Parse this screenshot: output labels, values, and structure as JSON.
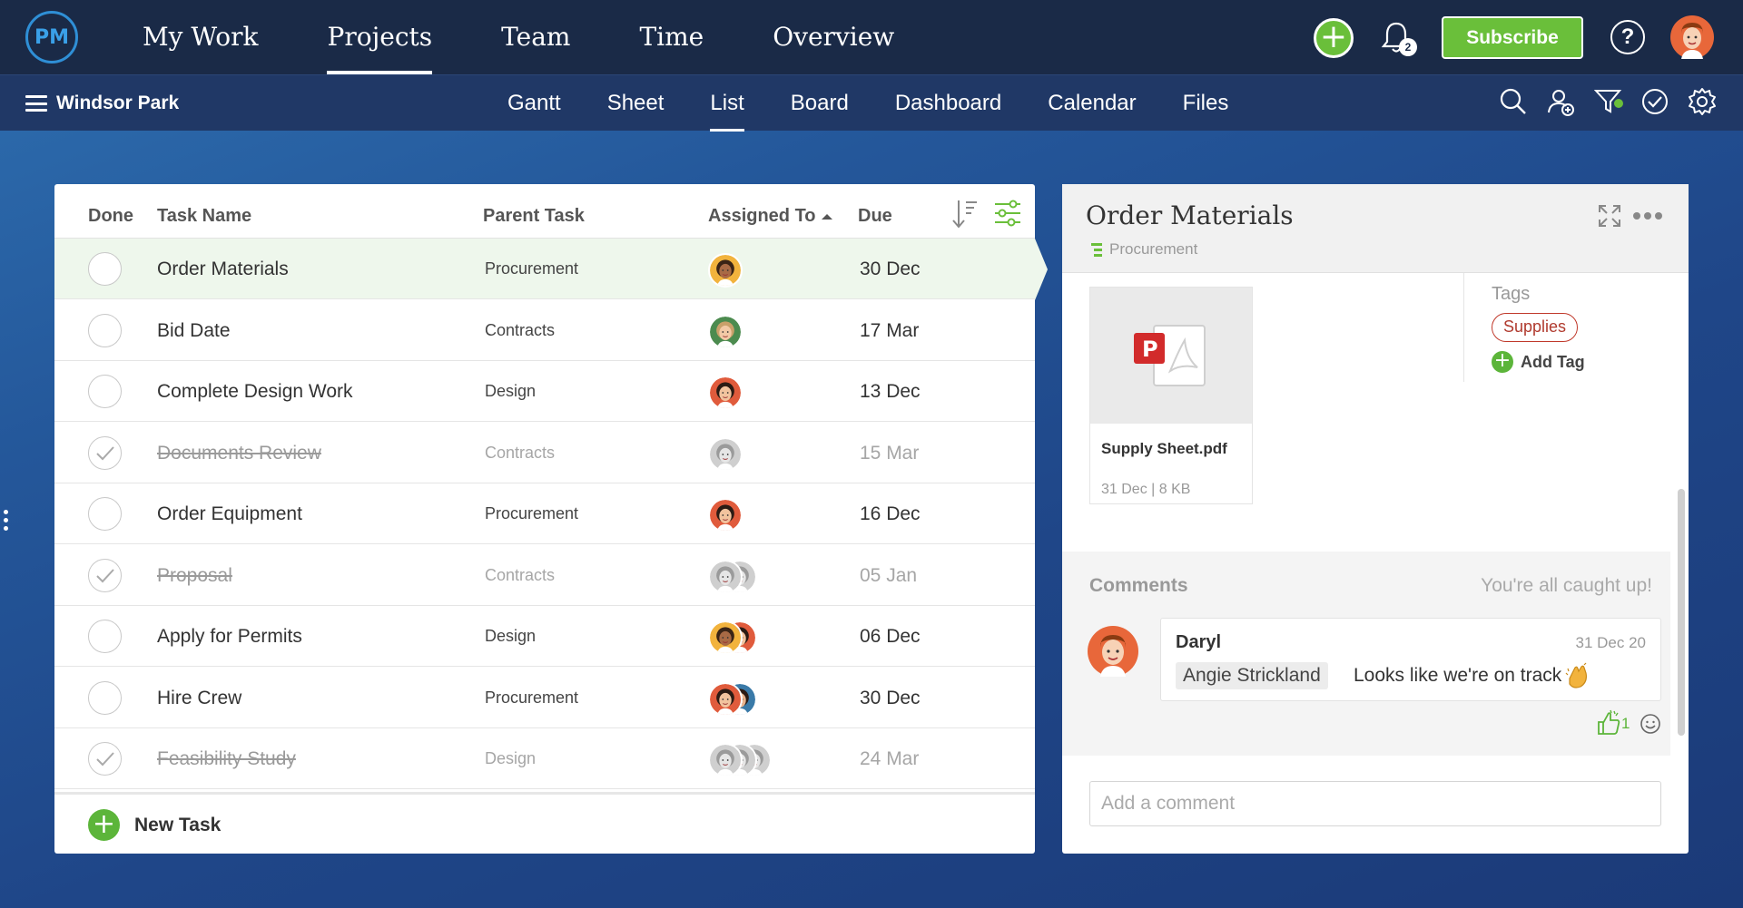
{
  "logo": "PM",
  "main_nav": [
    {
      "label": "My Work",
      "active": false
    },
    {
      "label": "Projects",
      "active": true
    },
    {
      "label": "Team",
      "active": false
    },
    {
      "label": "Time",
      "active": false
    },
    {
      "label": "Overview",
      "active": false
    }
  ],
  "notifications_count": "2",
  "subscribe_label": "Subscribe",
  "help_label": "?",
  "project_name": "Windsor Park",
  "views": [
    {
      "label": "Gantt",
      "active": false
    },
    {
      "label": "Sheet",
      "active": false
    },
    {
      "label": "List",
      "active": true
    },
    {
      "label": "Board",
      "active": false
    },
    {
      "label": "Dashboard",
      "active": false
    },
    {
      "label": "Calendar",
      "active": false
    },
    {
      "label": "Files",
      "active": false
    }
  ],
  "table": {
    "headers": {
      "done": "Done",
      "task_name": "Task Name",
      "parent_task": "Parent Task",
      "assigned_to": "Assigned To",
      "due": "Due"
    },
    "rows": [
      {
        "name": "Order Materials",
        "parent": "Procurement",
        "due": "30 Dec",
        "done": false,
        "selected": true,
        "assignees": [
          "woman-dark-hair"
        ]
      },
      {
        "name": "Bid Date",
        "parent": "Contracts",
        "due": "17 Mar",
        "done": false,
        "selected": false,
        "assignees": [
          "man-green"
        ]
      },
      {
        "name": "Complete Design Work",
        "parent": "Design",
        "due": "13 Dec",
        "done": false,
        "selected": false,
        "assignees": [
          "woman-red"
        ]
      },
      {
        "name": "Documents Review",
        "parent": "Contracts",
        "due": "15 Mar",
        "done": true,
        "selected": false,
        "assignees": [
          "grey"
        ]
      },
      {
        "name": "Order Equipment",
        "parent": "Procurement",
        "due": "16 Dec",
        "done": false,
        "selected": false,
        "assignees": [
          "woman-red"
        ]
      },
      {
        "name": "Proposal",
        "parent": "Contracts",
        "due": "05 Jan",
        "done": true,
        "selected": false,
        "assignees": [
          "grey",
          "grey"
        ]
      },
      {
        "name": "Apply for Permits",
        "parent": "Design",
        "due": "06 Dec",
        "done": false,
        "selected": false,
        "assignees": [
          "woman-dark-hair",
          "woman-red"
        ]
      },
      {
        "name": "Hire Crew",
        "parent": "Procurement",
        "due": "30 Dec",
        "done": false,
        "selected": false,
        "assignees": [
          "woman-red",
          "man-blue"
        ]
      },
      {
        "name": "Feasibility Study",
        "parent": "Design",
        "due": "24 Mar",
        "done": true,
        "selected": false,
        "assignees": [
          "grey",
          "grey",
          "grey"
        ]
      }
    ],
    "new_task_label": "New Task"
  },
  "detail": {
    "title": "Order Materials",
    "parent": "Procurement",
    "file": {
      "name": "Supply Sheet.pdf",
      "meta": "31 Dec | 8 KB"
    },
    "tags_label": "Tags",
    "tags": [
      "Supplies"
    ],
    "add_tag_label": "Add Tag",
    "comments_label": "Comments",
    "caught_up": "You're all caught up!",
    "comment": {
      "author": "Daryl",
      "date": "31 Dec 20",
      "mention": "Angie Strickland",
      "text": "Looks like we're on track"
    },
    "likes": "1",
    "comment_placeholder": "Add a comment"
  },
  "colors": {
    "accent_green": "#6abf3a",
    "nav_bg": "#1a2a47",
    "subnav_bg": "#203866",
    "tag_red": "#c0392b"
  }
}
